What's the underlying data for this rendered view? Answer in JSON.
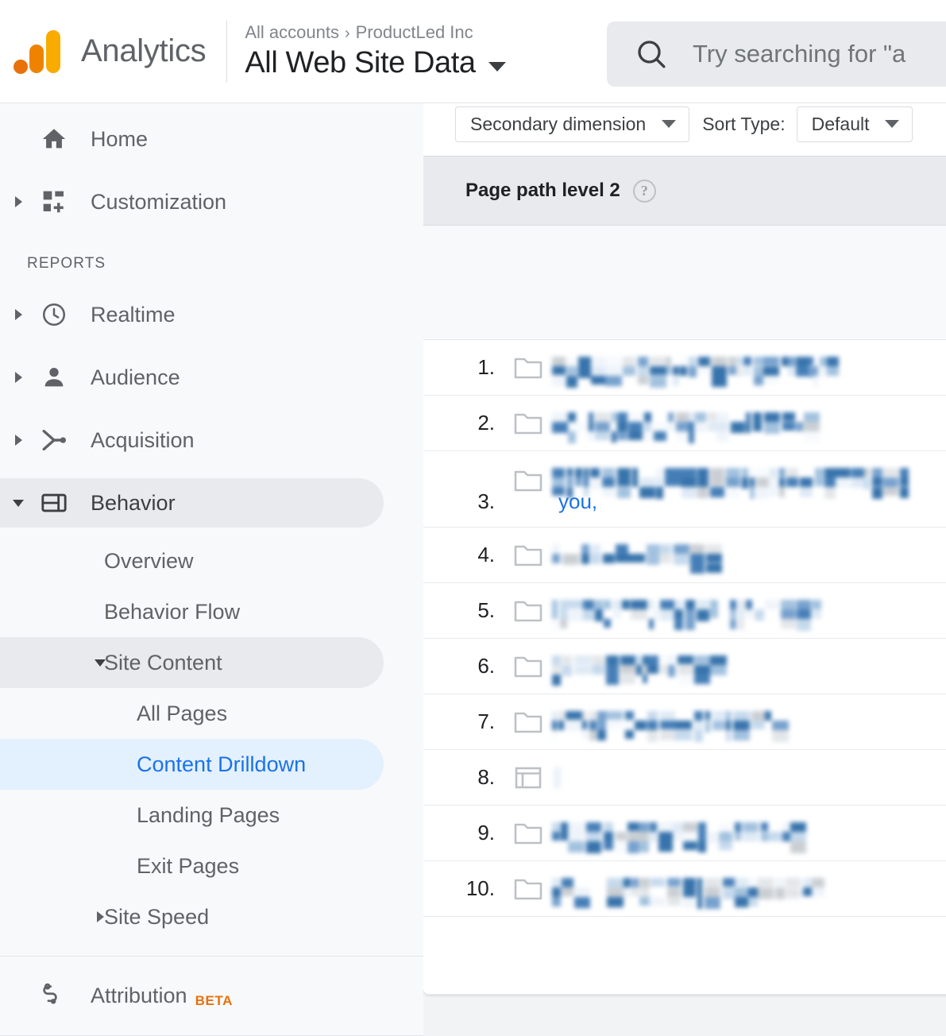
{
  "header": {
    "brand": "Analytics",
    "logo_colors": {
      "dot": "#e8710a",
      "mid": "#ef8300",
      "tall": "#f9ab00"
    },
    "breadcrumb": {
      "account": "All accounts",
      "separator": "›",
      "property": "ProductLed Inc"
    },
    "view_name": "All Web Site Data",
    "view_caret": "chevron-down-icon"
  },
  "search": {
    "placeholder": "Try searching for \"a",
    "icon": "search-icon",
    "value": ""
  },
  "sidebar": {
    "items": [
      {
        "label": "Home",
        "icon": "home-icon",
        "expandable": false,
        "state": "default",
        "level": 0
      },
      {
        "label": "Customization",
        "icon": "customization-icon",
        "expandable": true,
        "state": "default",
        "level": 0
      }
    ],
    "section_label": "REPORTS",
    "reports": [
      {
        "label": "Realtime",
        "icon": "clock-icon",
        "expandable": true,
        "state": "default"
      },
      {
        "label": "Audience",
        "icon": "person-icon",
        "expandable": true,
        "state": "default"
      },
      {
        "label": "Acquisition",
        "icon": "acquisition-icon",
        "expandable": true,
        "state": "default"
      },
      {
        "label": "Behavior",
        "icon": "behavior-icon",
        "expandable": true,
        "state": "selected-gray",
        "expanded": true
      }
    ],
    "behavior_children": [
      {
        "label": "Overview",
        "state": "default",
        "level": 1,
        "expandable": false
      },
      {
        "label": "Behavior Flow",
        "state": "default",
        "level": 1,
        "expandable": false
      },
      {
        "label": "Site Content",
        "state": "selected-gray",
        "level": 1,
        "expandable": true,
        "expanded": true
      },
      {
        "label": "All Pages",
        "state": "default",
        "level": 2,
        "expandable": false
      },
      {
        "label": "Content Drilldown",
        "state": "selected-blue",
        "level": 2,
        "expandable": false
      },
      {
        "label": "Landing Pages",
        "state": "default",
        "level": 2,
        "expandable": false
      },
      {
        "label": "Exit Pages",
        "state": "default",
        "level": 2,
        "expandable": false
      },
      {
        "label": "Site Speed",
        "state": "default",
        "level": 1,
        "expandable": true,
        "expanded": false
      }
    ],
    "footer": {
      "label": "Attribution",
      "badge": "BETA",
      "icon": "attribution-icon",
      "badge_color": "#e8710a"
    }
  },
  "report": {
    "toolbar": {
      "secondary_dimension_label": "Secondary dimension",
      "secondary_dimension_icon": "chevron-down-icon",
      "sort_type_label": "Sort Type:",
      "sort_type_value": "Default",
      "sort_type_icon": "chevron-down-icon"
    },
    "table": {
      "column_header": "Page path level 2",
      "header_help_icon": "help-icon",
      "rows": [
        {
          "index": "1.",
          "icon": "folder-icon",
          "value": "",
          "redacted": true,
          "blur_width": 362,
          "partial_text": ""
        },
        {
          "index": "2.",
          "icon": "folder-icon",
          "value": "",
          "redacted": true,
          "blur_width": 325,
          "partial_text": ""
        },
        {
          "index": "3.",
          "icon": "folder-icon",
          "value": "",
          "redacted": true,
          "blur_width": 442,
          "partial_text": "you,"
        },
        {
          "index": "4.",
          "icon": "folder-icon",
          "value": "",
          "redacted": true,
          "blur_width": 212,
          "partial_text": ""
        },
        {
          "index": "5.",
          "icon": "folder-icon",
          "value": "",
          "redacted": true,
          "blur_width": 332,
          "partial_text": ""
        },
        {
          "index": "6.",
          "icon": "folder-icon",
          "value": "",
          "redacted": true,
          "blur_width": 220,
          "partial_text": ""
        },
        {
          "index": "7.",
          "icon": "folder-icon",
          "value": "",
          "redacted": true,
          "blur_width": 294,
          "partial_text": ""
        },
        {
          "index": "8.",
          "icon": "page-icon",
          "value": "",
          "redacted": true,
          "blur_width": 10,
          "partial_text": ""
        },
        {
          "index": "9.",
          "icon": "folder-icon",
          "value": "",
          "redacted": true,
          "blur_width": 310,
          "partial_text": ""
        },
        {
          "index": "10.",
          "icon": "folder-icon",
          "value": "",
          "redacted": true,
          "blur_width": 328,
          "partial_text": ""
        }
      ]
    }
  },
  "colors": {
    "accent_blue": "#1a73e8",
    "selected_blue_bg": "#e3f0fd",
    "selected_gray_bg": "#e8eaed",
    "page_bg": "#f1f3f4",
    "sidebar_bg": "#f8f9fa",
    "text_primary": "#202124",
    "text_secondary": "#5f6368"
  }
}
